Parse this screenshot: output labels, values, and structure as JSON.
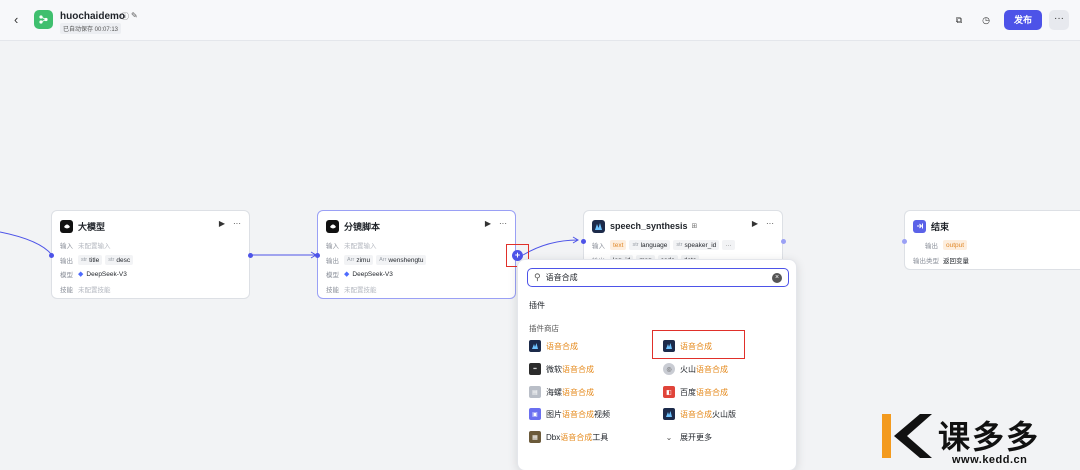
{
  "header": {
    "title": "huochaidemo",
    "autosave": "已自动保存 00:07:13",
    "publish_label": "发布",
    "more_label": "···"
  },
  "nodes": {
    "llm": {
      "title": "大模型",
      "input_key": "输入",
      "input_val": "未配置输入",
      "output_key": "输出",
      "outputs": [
        "title",
        "desc"
      ],
      "model_key": "模型",
      "model": "DeepSeek-V3",
      "skill_key": "技能",
      "skill_val": "未配置技能",
      "type_tag": "str"
    },
    "storyboard": {
      "title": "分镜脚本",
      "input_key": "输入",
      "input_val": "未配置输入",
      "output_key": "输出",
      "outputs": [
        "zimu",
        "wenshengtu"
      ],
      "model_key": "模型",
      "model": "DeepSeek-V3",
      "skill_key": "技能",
      "skill_val": "未配置技能",
      "type_tag": "Arr"
    },
    "speech": {
      "title": "speech_synthesis",
      "input_key": "输入",
      "inputs": [
        "text",
        "language",
        "speaker_id"
      ],
      "output_key": "输出",
      "outputs": [
        "log_id",
        "msg",
        "code",
        "data"
      ]
    },
    "end": {
      "title": "结束",
      "output_key": "输出",
      "output_val": "output",
      "outtype_key": "输出类型",
      "outtype_val": "返回变量"
    }
  },
  "plugin_panel": {
    "search_value": "语音合成",
    "section_title": "插件",
    "store_title": "插件商店",
    "items": [
      {
        "prefix": "",
        "hl": "语音合成",
        "suffix": "",
        "icon": "speech-plugin-icon",
        "color": "#1c2a4a"
      },
      {
        "prefix": "",
        "hl": "语音合成",
        "suffix": "",
        "icon": "speech-plugin-icon",
        "color": "#1c2a4a"
      },
      {
        "prefix": "微软",
        "hl": "语音合成",
        "suffix": "",
        "icon": "microsoft-icon",
        "color": "#2b2b2b"
      },
      {
        "prefix": "火山",
        "hl": "语音合成",
        "suffix": "",
        "icon": "volcano-icon",
        "color": "#c9ccd3"
      },
      {
        "prefix": "海螺",
        "hl": "语音合成",
        "suffix": "",
        "icon": "hailuo-icon",
        "color": "#b9bec7"
      },
      {
        "prefix": "百度",
        "hl": "语音合成",
        "suffix": "",
        "icon": "baidu-icon",
        "color": "#e0443a"
      },
      {
        "prefix": "图片",
        "hl": "语音合成",
        "suffix": "视频",
        "icon": "image-icon",
        "color": "#6a6ff0"
      },
      {
        "prefix": "",
        "hl": "语音合成",
        "suffix": "火山版",
        "icon": "speech-plugin-icon",
        "color": "#1c2a4a"
      },
      {
        "prefix": "Dbx",
        "hl": "语音合成",
        "suffix": "工具",
        "icon": "dbx-icon",
        "color": "#6b5a3a"
      }
    ],
    "expand_more": "展开更多"
  },
  "watermark": {
    "brand": "课多多",
    "url": "www.kedd.cn"
  },
  "colors": {
    "accent": "#4d53e8",
    "highlight": "#e58a1c",
    "annotation": "#e0302a"
  }
}
